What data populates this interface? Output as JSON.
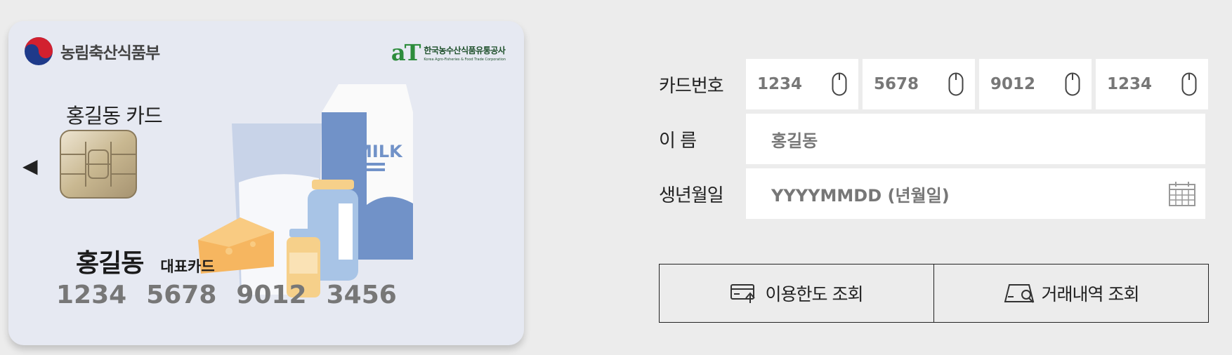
{
  "card": {
    "ministry": "농림축산식품부",
    "agency_logo": "aT",
    "agency_ko": "한국농수산식품유통공사",
    "agency_en": "Korea Agro-Fisheries & Food Trade Corporation",
    "title": "홍길동 카드",
    "holder_name": "홍길동",
    "holder_type": "대표카드",
    "number": [
      "1234",
      "5678",
      "9012",
      "3456"
    ],
    "milk_label": "MILK"
  },
  "form": {
    "card_number_label": "카드번호",
    "card_number": [
      "1234",
      "5678",
      "9012",
      "1234"
    ],
    "name_label": "이 름",
    "name_value": "홍길동",
    "birth_label": "생년월일",
    "birth_placeholder": "YYYYMMDD (년월일)"
  },
  "actions": {
    "limit_label": "이용한도 조회",
    "history_label": "거래내역 조회"
  },
  "icons": {
    "prev": "triangle-left-icon",
    "mouse": "mouse-icon",
    "calendar": "calendar-icon",
    "limit": "card-limit-icon",
    "history": "transaction-search-icon"
  }
}
